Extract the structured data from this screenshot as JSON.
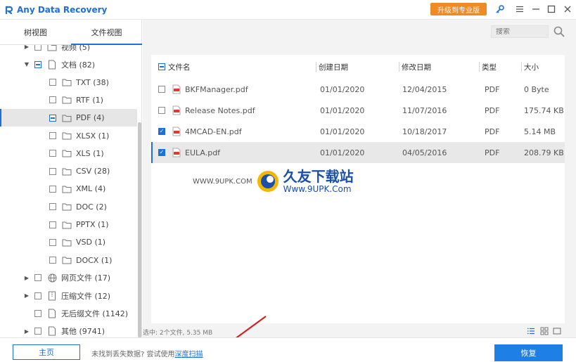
{
  "app": {
    "title": "Any Data Recovery",
    "accent_color": "#1e6fd9",
    "upgrade_color": "#f08a22"
  },
  "titlebar": {
    "upgrade_label": "升级到专业版",
    "icons": [
      "key-icon",
      "menu-icon",
      "minimize-icon",
      "maximize-icon",
      "close-icon"
    ]
  },
  "view_tabs": [
    {
      "label": "树视图",
      "active": false
    },
    {
      "label": "文件视图",
      "active": true
    }
  ],
  "tree": {
    "rows": [
      {
        "label": "视频 (5)",
        "level": 1,
        "expand": "collapsed",
        "check": "none",
        "icon": "folder-icon"
      },
      {
        "label": "文档 (82)",
        "level": 1,
        "expand": "expanded",
        "check": "partial",
        "icon": "document-icon"
      },
      {
        "label": "TXT (38)",
        "level": 2,
        "check": "none",
        "icon": "folder-icon"
      },
      {
        "label": "RTF (1)",
        "level": 2,
        "check": "none",
        "icon": "folder-icon"
      },
      {
        "label": "PDF (4)",
        "level": 2,
        "check": "partial",
        "icon": "folder-icon",
        "selected": true
      },
      {
        "label": "XLSX (1)",
        "level": 2,
        "check": "none",
        "icon": "folder-icon"
      },
      {
        "label": "XLS (1)",
        "level": 2,
        "check": "none",
        "icon": "folder-icon"
      },
      {
        "label": "CSV (28)",
        "level": 2,
        "check": "none",
        "icon": "folder-icon"
      },
      {
        "label": "XML (4)",
        "level": 2,
        "check": "none",
        "icon": "folder-icon"
      },
      {
        "label": "DOC (2)",
        "level": 2,
        "check": "none",
        "icon": "folder-icon"
      },
      {
        "label": "PPTX (1)",
        "level": 2,
        "check": "none",
        "icon": "folder-icon"
      },
      {
        "label": "VSD (1)",
        "level": 2,
        "check": "none",
        "icon": "folder-icon"
      },
      {
        "label": "DOCX (1)",
        "level": 2,
        "check": "none",
        "icon": "folder-icon"
      },
      {
        "label": "网页文件 (17)",
        "level": 1,
        "expand": "collapsed",
        "check": "none",
        "icon": "globe-icon"
      },
      {
        "label": "压缩文件 (12)",
        "level": 1,
        "expand": "collapsed",
        "check": "none",
        "icon": "archive-icon"
      },
      {
        "label": "无后缀文件 (1142)",
        "level": 1,
        "expand": "none",
        "check": "none",
        "icon": "document-icon"
      },
      {
        "label": "其他 (9741)",
        "level": 1,
        "expand": "collapsed",
        "check": "none",
        "icon": "document-icon"
      }
    ]
  },
  "search": {
    "placeholder": "搜索"
  },
  "table": {
    "headers": {
      "name": "文件名",
      "created": "创建日期",
      "modified": "修改日期",
      "type": "类型",
      "size": "大小"
    },
    "rows": [
      {
        "name": "BKFManager.pdf",
        "created": "01/01/2020",
        "modified": "12/04/2015",
        "type": "PDF",
        "size": "0 Byte",
        "checked": false,
        "selected": false
      },
      {
        "name": "Release Notes.pdf",
        "created": "01/01/2020",
        "modified": "11/07/2016",
        "type": "PDF",
        "size": "175.74 KB",
        "checked": false,
        "selected": false
      },
      {
        "name": "4MCAD-EN.pdf",
        "created": "01/01/2020",
        "modified": "10/18/2017",
        "type": "PDF",
        "size": "5.14 MB",
        "checked": true,
        "selected": false
      },
      {
        "name": "EULA.pdf",
        "created": "01/01/2020",
        "modified": "04/05/2016",
        "type": "PDF",
        "size": "208.79 KB",
        "checked": true,
        "selected": true
      }
    ]
  },
  "status": {
    "text": "选中: 2个文件, 5.35 MB"
  },
  "watermark": {
    "url": "WWW.9UPK.COM",
    "title": "久友下载站",
    "subtitle": "Www.9UPK.Com"
  },
  "bottom": {
    "home_label": "主页",
    "hint_text": "未找到丢失数据? 尝试使用",
    "hint_link": "深度扫描",
    "recover_label": "恢复"
  }
}
